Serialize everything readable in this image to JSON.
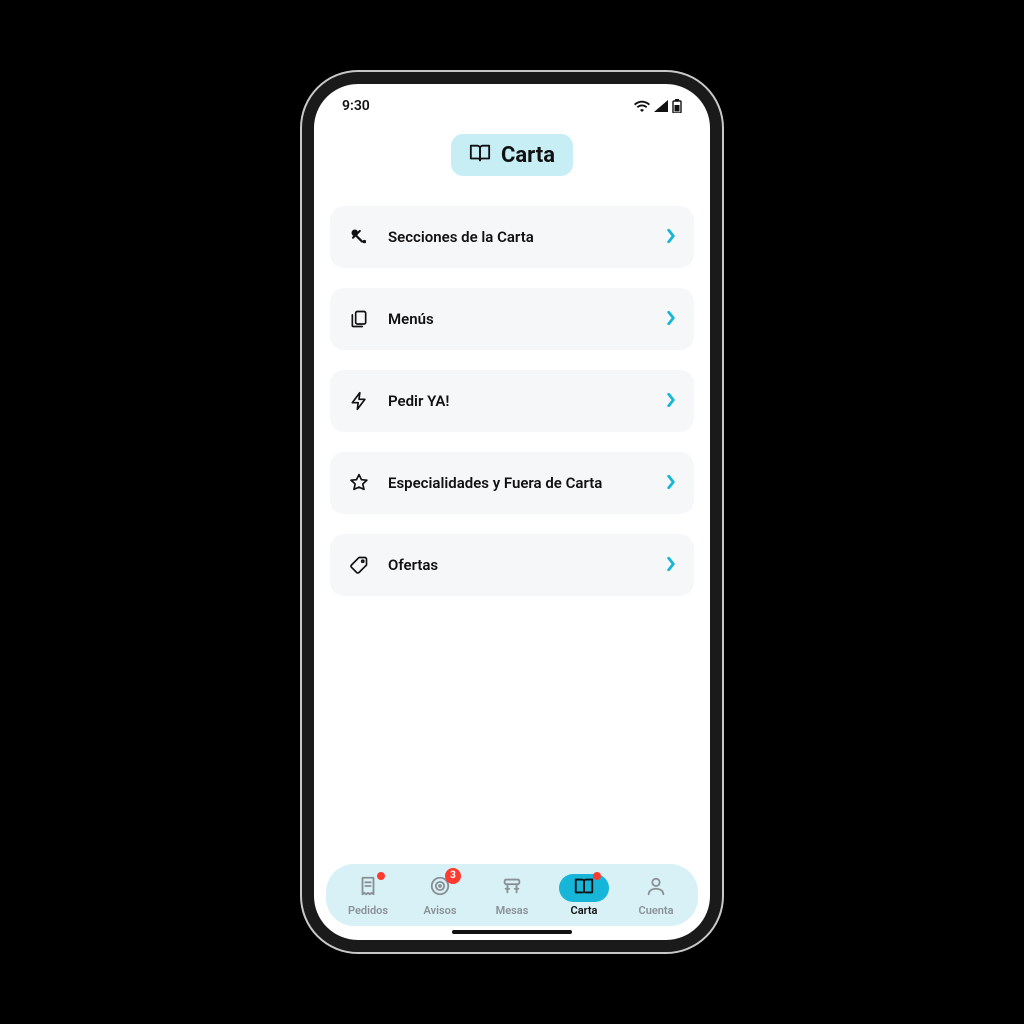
{
  "statusbar": {
    "time": "9:30"
  },
  "header": {
    "title": "Carta"
  },
  "menu": {
    "items": [
      {
        "label": "Secciones de la Carta",
        "icon": "utensils-icon"
      },
      {
        "label": "Menús",
        "icon": "copy-icon"
      },
      {
        "label": "Pedir YA!",
        "icon": "bolt-icon"
      },
      {
        "label": "Especialidades y Fuera de Carta",
        "icon": "star-icon"
      },
      {
        "label": "Ofertas",
        "icon": "tag-icon"
      }
    ]
  },
  "tabs": {
    "items": [
      {
        "label": "Pedidos",
        "icon": "receipt-icon",
        "badge_dot": true,
        "badge_count": null,
        "active": false
      },
      {
        "label": "Avisos",
        "icon": "target-icon",
        "badge_dot": false,
        "badge_count": "3",
        "active": false
      },
      {
        "label": "Mesas",
        "icon": "table-icon",
        "badge_dot": false,
        "badge_count": null,
        "active": false
      },
      {
        "label": "Carta",
        "icon": "book-icon",
        "badge_dot": true,
        "badge_count": null,
        "active": true
      },
      {
        "label": "Cuenta",
        "icon": "person-icon",
        "badge_dot": false,
        "badge_count": null,
        "active": false
      }
    ]
  },
  "colors": {
    "accent": "#17b6d9",
    "pill": "#c7edf5",
    "card": "#f6f7f8",
    "badge": "#ff3b30"
  }
}
